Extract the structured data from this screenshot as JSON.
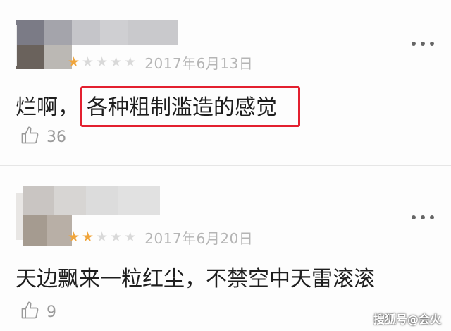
{
  "comments": [
    {
      "rating": 1,
      "max_rating": 5,
      "date": "2017年6月13日",
      "text_before": "烂啊，",
      "text_highlighted": "各种粗制滥造的感觉",
      "likes": "36",
      "highlight_color": "#e3202f"
    },
    {
      "rating": 2,
      "max_rating": 5,
      "date": "2017年6月20日",
      "text": "天边飘来一粒红尘，不禁空中天雷滚滚",
      "likes": "9"
    }
  ],
  "colors": {
    "star_active": "#f0a53b",
    "star_inactive": "#d9d9d9",
    "date": "#b5b5b5"
  },
  "icons": {
    "more": "more-dots-icon",
    "like": "thumbs-up-icon"
  },
  "watermark": "搜狐号@会火"
}
